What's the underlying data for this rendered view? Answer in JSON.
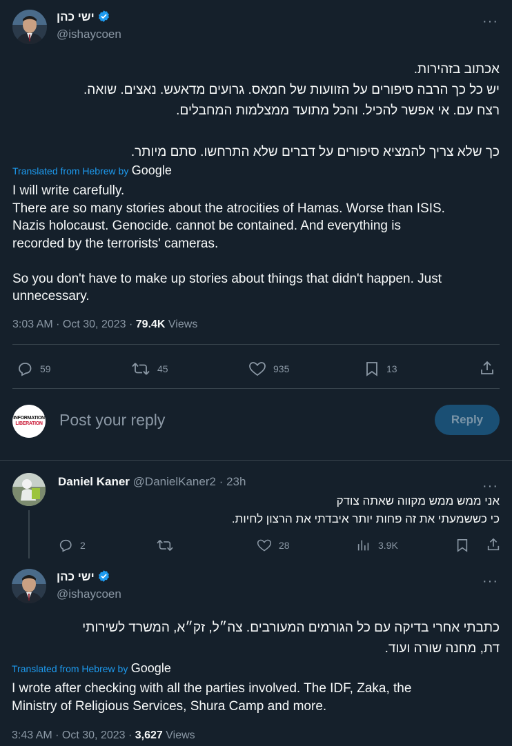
{
  "main_tweet": {
    "name": "ישי כהן",
    "handle": "@ishaycoen",
    "hebrew_text": "אכתוב בזהירות.\nיש כל כך הרבה סיפורים על הזוועות של חמאס. גרועים מדאעש. נאצים. שואה.\nרצח עם. אי אפשר להכיל. והכל מתועד ממצלמות המחבלים.\n\nכך שלא צריך להמציא סיפורים על דברים שלא התרחשו. סתם מיותר.",
    "translated_label": "Translated from Hebrew by",
    "translator": "Google",
    "english_text": "I will write carefully.\nThere are so many stories about the atrocities of Hamas. Worse than ISIS.\nNazis holocaust. Genocide. cannot be contained. And everything is\nrecorded by the terrorists' cameras.\n\nSo you don't have to make up stories about things that didn't happen. Just\nunnecessary.",
    "time": "3:03 AM",
    "date": "Oct 30, 2023",
    "views_count": "79.4K",
    "views_label": "Views",
    "stats": {
      "replies": "59",
      "retweets": "45",
      "likes": "935",
      "bookmarks": "13"
    }
  },
  "compose": {
    "avatar_line1": "INFORMATION",
    "avatar_line2": "LIBERATION",
    "placeholder": "Post your reply",
    "reply_button": "Reply"
  },
  "reply_tweet": {
    "name": "Daniel Kaner",
    "handle": "@DanielKaner2",
    "time_ago": "23h",
    "hebrew_text": "אני ממש ממש מקווה שאתה צודק\nכי כששמעתי את זה פחות יותר איבדתי את הרצון לחיות.",
    "stats": {
      "replies": "2",
      "likes": "28",
      "views": "3.9K"
    }
  },
  "second_tweet": {
    "name": "ישי כהן",
    "handle": "@ishaycoen",
    "hebrew_text": "כתבתי אחרי בדיקה עם כל הגורמים המעורבים. צה״ל, זק״א, המשרד לשירותי\nדת, מחנה שורה ועוד.",
    "translated_label": "Translated from Hebrew by",
    "translator": "Google",
    "english_text": "I wrote after checking with all the parties involved. The IDF, Zaka, the\nMinistry of Religious Services, Shura Camp and more.",
    "time": "3:43 AM",
    "date": "Oct 30, 2023",
    "views_count": "3,627",
    "views_label": "Views"
  },
  "colors": {
    "background": "#15202b",
    "accent": "#1d9bf0",
    "muted": "#8b98a5",
    "divider": "#38444d"
  }
}
